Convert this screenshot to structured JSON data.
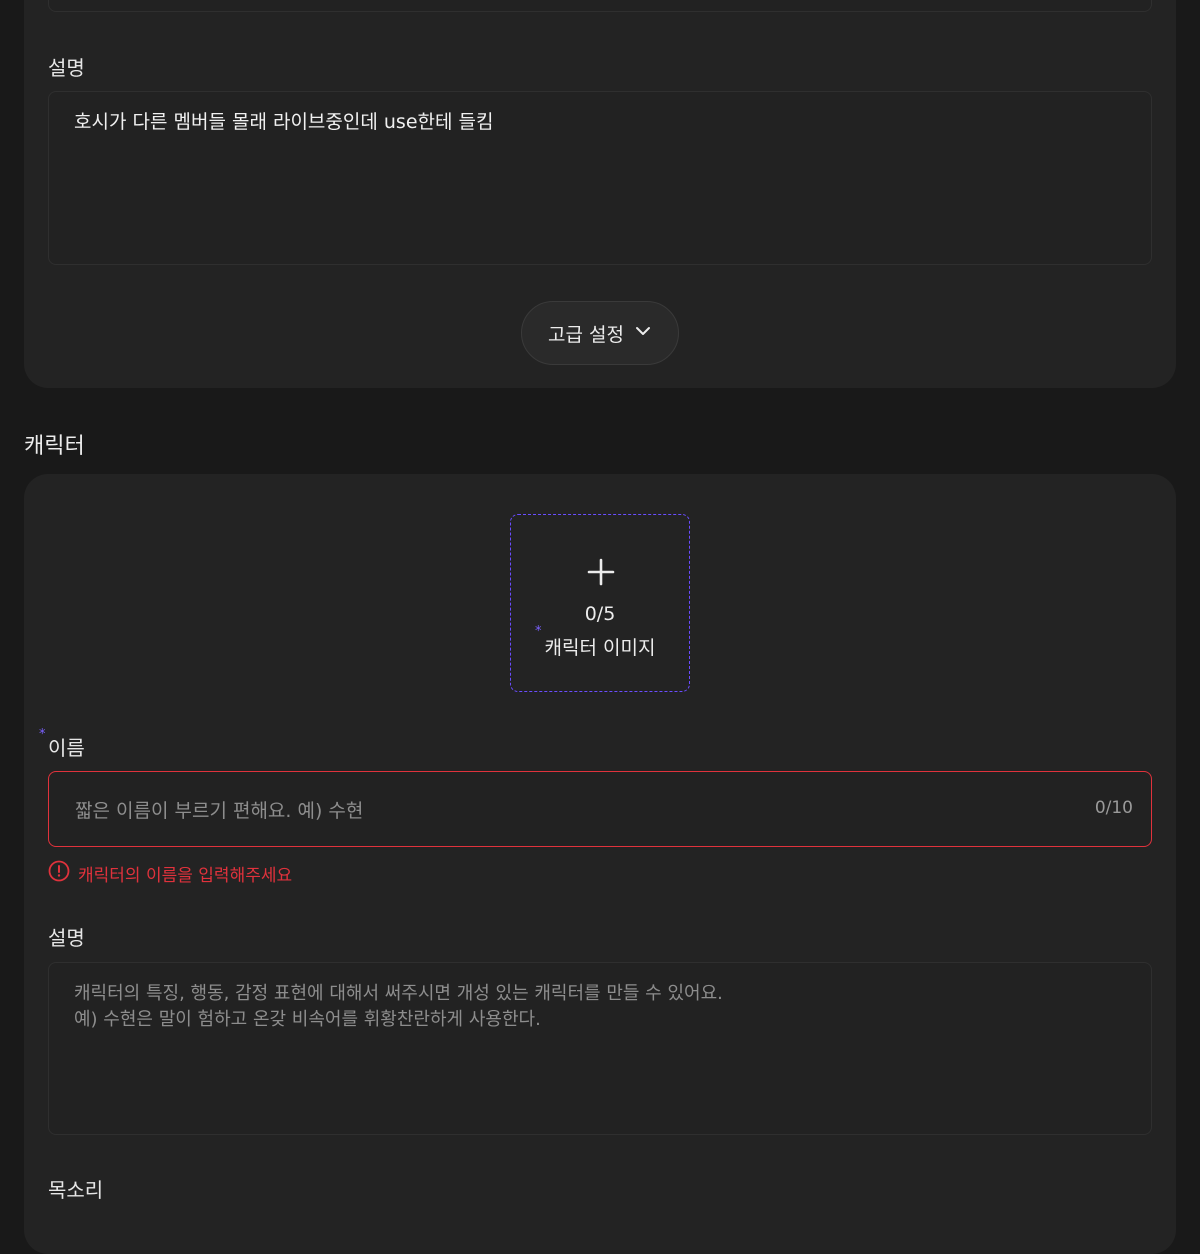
{
  "top_section": {
    "description_label": "설명",
    "description_value": "호시가 다른 멤버들 몰래 라이브중인데 use한테 들킴",
    "advanced_settings_label": "고급 설정"
  },
  "character_section": {
    "title": "캐릭터",
    "image_upload": {
      "count": "0/5",
      "label": "캐릭터 이미지"
    },
    "name": {
      "label": "이름",
      "placeholder": "짧은 이름이 부르기 편해요. 예) 수현",
      "counter": "0/10",
      "error": "캐릭터의 이름을 입력해주세요"
    },
    "description": {
      "label": "설명",
      "placeholder_line1": "캐릭터의 특징, 행동, 감정 표현에 대해서 써주시면 개성 있는 캐릭터를 만들 수 있어요.",
      "placeholder_line2": "예) 수현은 말이 험하고 온갖 비속어를 휘황찬란하게 사용한다."
    },
    "voice": {
      "label": "목소리"
    }
  },
  "colors": {
    "background": "#191919",
    "card": "#232323",
    "accent": "#6a4cff",
    "error": "#e0323c"
  }
}
